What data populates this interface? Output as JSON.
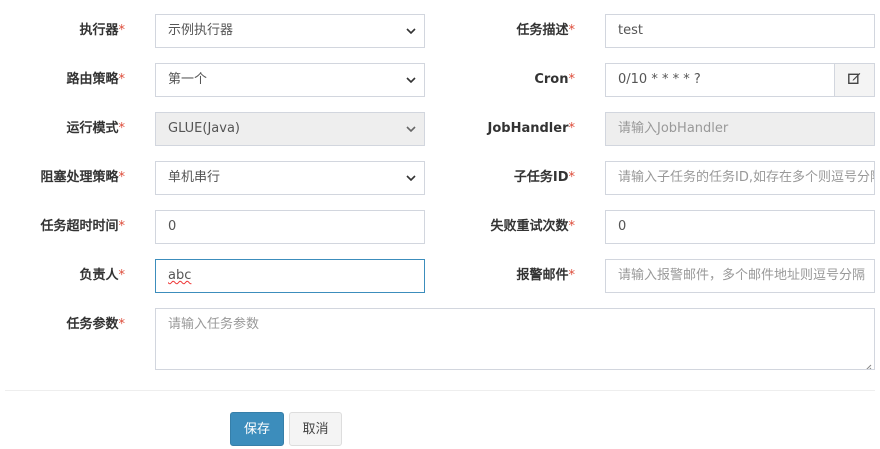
{
  "form": {
    "executor": {
      "label": "执行器",
      "value": "示例执行器"
    },
    "job_desc": {
      "label": "任务描述",
      "value": "test"
    },
    "route_strategy": {
      "label": "路由策略",
      "value": "第一个"
    },
    "cron": {
      "label": "Cron",
      "value": "0/10 * * * * ?",
      "edit_icon": "edit-icon"
    },
    "run_mode": {
      "label": "运行模式",
      "value": "GLUE(Java)"
    },
    "job_handler": {
      "label": "JobHandler",
      "placeholder": "请输入JobHandler"
    },
    "block_strategy": {
      "label": "阻塞处理策略",
      "value": "单机串行"
    },
    "child_job_id": {
      "label": "子任务ID",
      "placeholder": "请输入子任务的任务ID,如存在多个则逗号分隔"
    },
    "timeout": {
      "label": "任务超时时间",
      "value": "0"
    },
    "retry_count": {
      "label": "失败重试次数",
      "value": "0"
    },
    "author": {
      "label": "负责人",
      "value": "abc"
    },
    "alarm_email": {
      "label": "报警邮件",
      "placeholder": "请输入报警邮件，多个邮件地址则逗号分隔"
    },
    "job_param": {
      "label": "任务参数",
      "placeholder": "请输入任务参数"
    }
  },
  "required_mark": "*",
  "buttons": {
    "save": "保存",
    "cancel": "取消"
  },
  "colors": {
    "primary": "#3c8dbc",
    "required": "#dd4b39",
    "focus_border": "#3c8dbc"
  }
}
